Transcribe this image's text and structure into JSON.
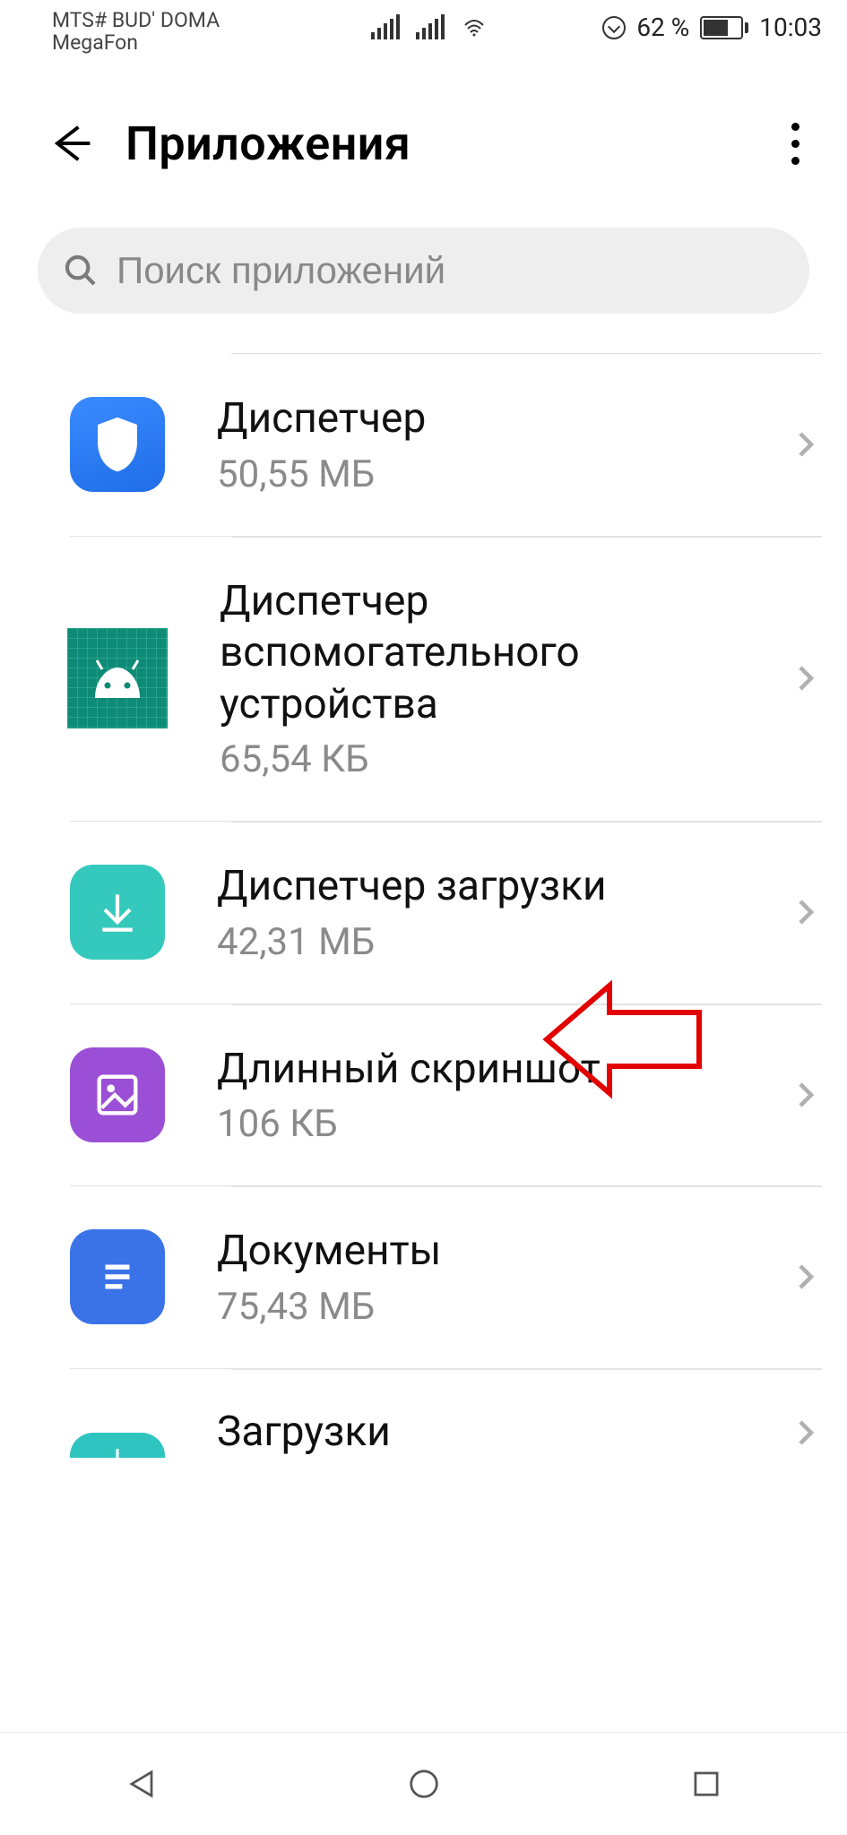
{
  "statusbar": {
    "carrier_line1": "MTS# BUD' DOMA",
    "carrier_line2": "MegaFon",
    "battery_pct": "62 %",
    "time": "10:03"
  },
  "header": {
    "title": "Приложения"
  },
  "search": {
    "placeholder": "Поиск приложений"
  },
  "apps": [
    {
      "name": "Диспетчер",
      "size": "50,55 МБ",
      "icon": "shield"
    },
    {
      "name": "Диспетчер вспомогательного устройства",
      "size": "65,54 КБ",
      "icon": "android-grid"
    },
    {
      "name": "Диспетчер загрузки",
      "size": "42,31 МБ",
      "icon": "download"
    },
    {
      "name": "Длинный скриншот",
      "size": "106 КБ",
      "icon": "screenshot"
    },
    {
      "name": "Документы",
      "size": "75,43 МБ",
      "icon": "docs"
    },
    {
      "name": "Загрузки",
      "size": "",
      "icon": "downloads2"
    }
  ],
  "annotation": {
    "target_index": 2,
    "shape": "red-arrow-pointing-left"
  }
}
